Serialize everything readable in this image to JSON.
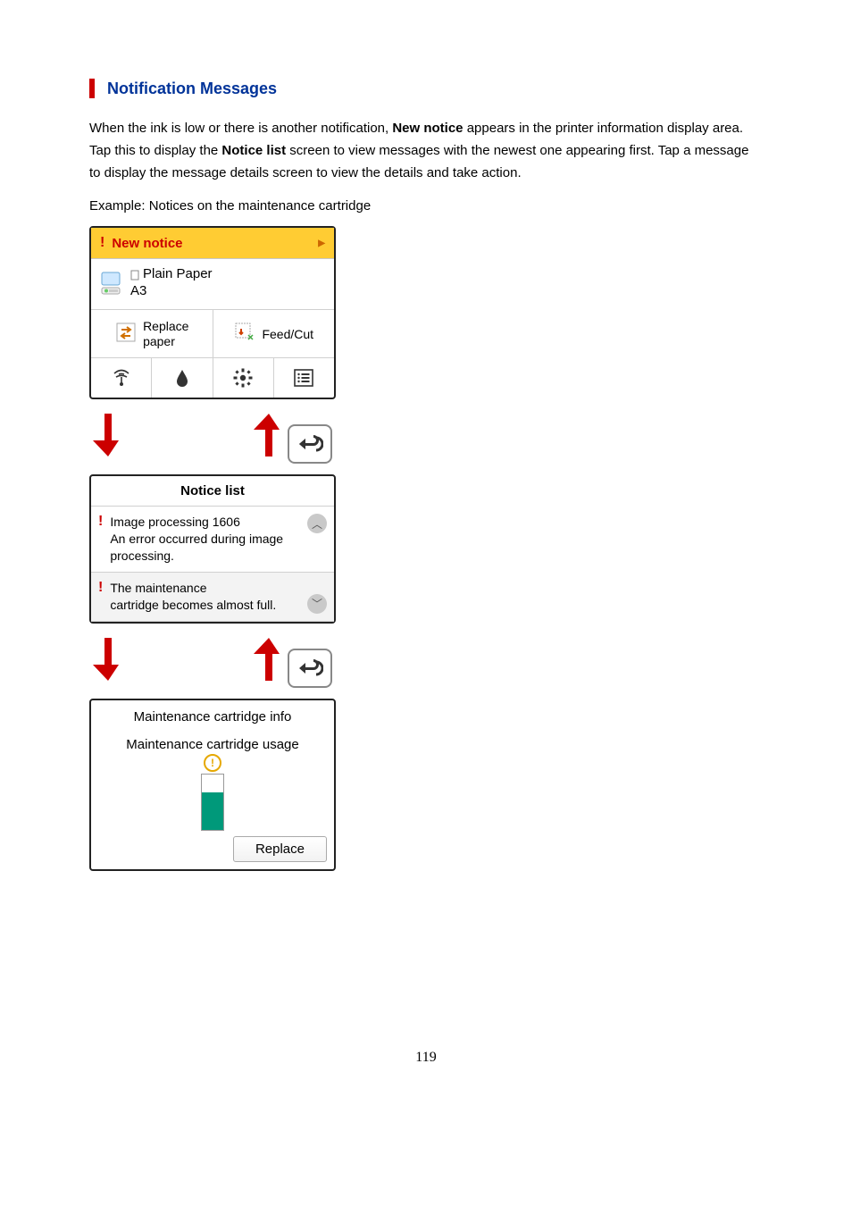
{
  "heading": "Notification Messages",
  "para_parts": {
    "p1a": "When the ink is low or there is another notification, ",
    "p1b": "New notice",
    "p1c": " appears in the printer information display area. Tap this to display the ",
    "p1d": "Notice list",
    "p1e": " screen to view messages with the newest one appearing first. Tap a message to display the message details screen to view the details and take action."
  },
  "example_line": "Example: Notices on the maintenance cartridge",
  "panel1": {
    "notice_label": "New notice",
    "paper_line1": "Plain Paper",
    "paper_line2": "A3",
    "replace_paper_line1": "Replace",
    "replace_paper_line2": "paper",
    "feed_cut": "Feed/Cut"
  },
  "panel2": {
    "title": "Notice list",
    "item1_line1": "Image processing 1606",
    "item1_line2": "An error occurred during image processing.",
    "item2_line1": "The maintenance",
    "item2_line2": "cartridge becomes almost full."
  },
  "panel3": {
    "title": "Maintenance cartridge info",
    "subtitle": "Maintenance cartridge usage",
    "replace_btn": "Replace"
  },
  "page_number": "119"
}
